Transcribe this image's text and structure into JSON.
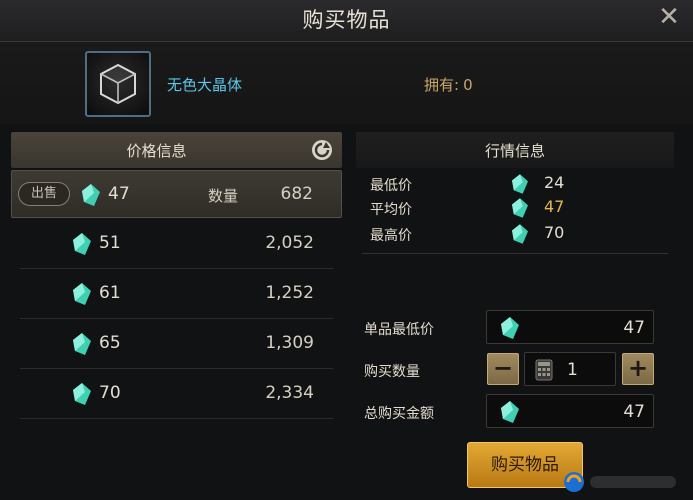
{
  "window": {
    "title": "购买物品"
  },
  "item": {
    "name": "无色大晶体",
    "owned_label": "拥有:",
    "owned_value": "0"
  },
  "price_panel": {
    "title": "价格信息",
    "qty_label": "数量",
    "sell_badge": "出售",
    "rows": [
      {
        "price": "47",
        "quantity": "682"
      },
      {
        "price": "51",
        "quantity": "2,052"
      },
      {
        "price": "61",
        "quantity": "1,252"
      },
      {
        "price": "65",
        "quantity": "1,309"
      },
      {
        "price": "70",
        "quantity": "2,334"
      }
    ]
  },
  "market_panel": {
    "title": "行情信息",
    "lowest_label": "最低价",
    "lowest_value": "24",
    "average_label": "平均价",
    "average_value": "47",
    "highest_label": "最高价",
    "highest_value": "70"
  },
  "purchase": {
    "unit_min_label": "单品最低价",
    "unit_min_value": "47",
    "qty_label": "购买数量",
    "qty_value": "1",
    "total_label": "总购买金额",
    "total_value": "47",
    "buy_label": "购买物品"
  },
  "colors": {
    "gem": "#3fd0b4",
    "highlight": "#e3b84a",
    "accent": "#5cc6e8",
    "buy_button": "#d9992a"
  }
}
